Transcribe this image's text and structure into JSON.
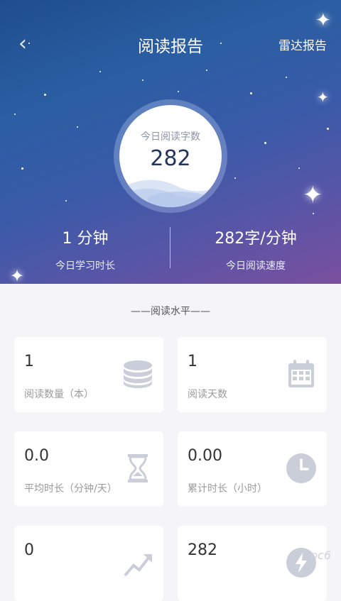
{
  "header": {
    "title": "阅读报告",
    "right_action": "雷达报告",
    "back_glyph": "‹"
  },
  "today": {
    "label": "今日阅读字数",
    "value": "282"
  },
  "stats": [
    {
      "value": "1 分钟",
      "label": "今日学习时长"
    },
    {
      "value": "282字/分钟",
      "label": "今日阅读速度"
    }
  ],
  "section": {
    "title": "——阅读水平——"
  },
  "cards": [
    {
      "value": "1",
      "label": "阅读数量（本）",
      "icon": "stack-icon"
    },
    {
      "value": "1",
      "label": "阅读天数",
      "icon": "calendar-icon"
    },
    {
      "value": "0.0",
      "label": "平均时长（分钟/天）",
      "icon": "hourglass-icon"
    },
    {
      "value": "0.00",
      "label": "累计时长（小时）",
      "icon": "clock-icon"
    },
    {
      "value": "0",
      "label": "",
      "icon": "trend-icon"
    },
    {
      "value": "282",
      "label": "",
      "icon": "lightning-icon"
    }
  ],
  "watermark": "pc6",
  "colors": {
    "icon_gray": "#c9ced8",
    "hero_start": "#1e4e8e",
    "hero_end": "#7a4f9e"
  }
}
